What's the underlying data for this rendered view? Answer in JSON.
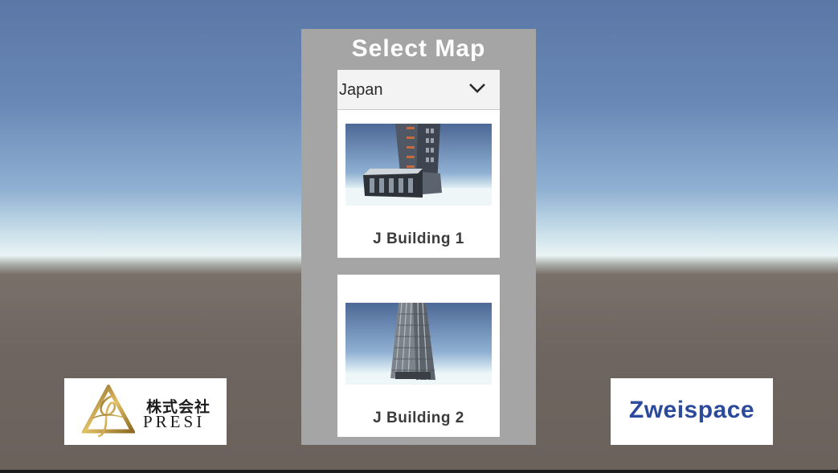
{
  "panel": {
    "title": "Select Map",
    "dropdown": {
      "selected": "Japan"
    },
    "maps": [
      {
        "label": "J Building 1"
      },
      {
        "label": "J Building 2"
      }
    ]
  },
  "logos": {
    "presi": {
      "company_jp": "株式会社",
      "company_en": "PRESI"
    },
    "zweispace": {
      "text": "Zweispace"
    }
  },
  "colors": {
    "panel_bg": "#a5a5a5",
    "zweispace_blue": "#2c4a9b",
    "presi_gold": "#c9a13b"
  }
}
